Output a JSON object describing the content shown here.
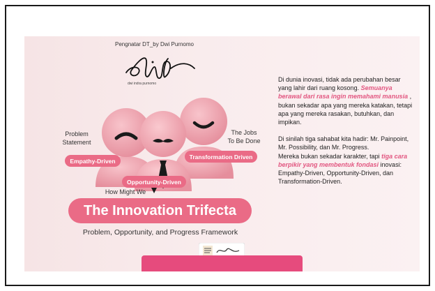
{
  "slide": {
    "credit": "Pengnatar DT_by Dwi Purnomo",
    "logo_caption": "dwi indra purnomo",
    "left_label": "Problem\nStatement",
    "left_pill": "Empathy-Driven",
    "center_pill": "Opportunity-Driven",
    "center_label": "How Might We",
    "right_label": "The Jobs\nTo Be Done",
    "right_pill": "Transformation Driven",
    "title": "The Innovation Trifecta",
    "subtitle": "Problem, Opportunity, and Progress Framework",
    "body": {
      "p1_before": "Di dunia inovasi, tidak ada perubahan besar yang lahir dari ruang kosong.",
      "p1_emphasis": "Semuanya berawal dari rasa ingin memahami manusia",
      "p1_after": ", bukan sekadar apa yang mereka katakan, tetapi apa yang mereka rasakan, butuhkan, dan impikan.",
      "p2": "Di sinilah tiga sahabat kita hadir: Mr. Painpoint, Mr. Possibility, dan Mr. Progress.",
      "p3_before": "Mereka bukan sekadar karakter, tapi",
      "p3_emphasis": "tiga cara berpikir yang membentuk fondasi",
      "p3_after": "inovasi: Empathy-Driven, Opportunity-Driven, dan Transformation-Driven."
    }
  },
  "colors": {
    "accent": "#ea6b86",
    "figure": "#f2a2ad",
    "bar": "#e64b7d"
  }
}
